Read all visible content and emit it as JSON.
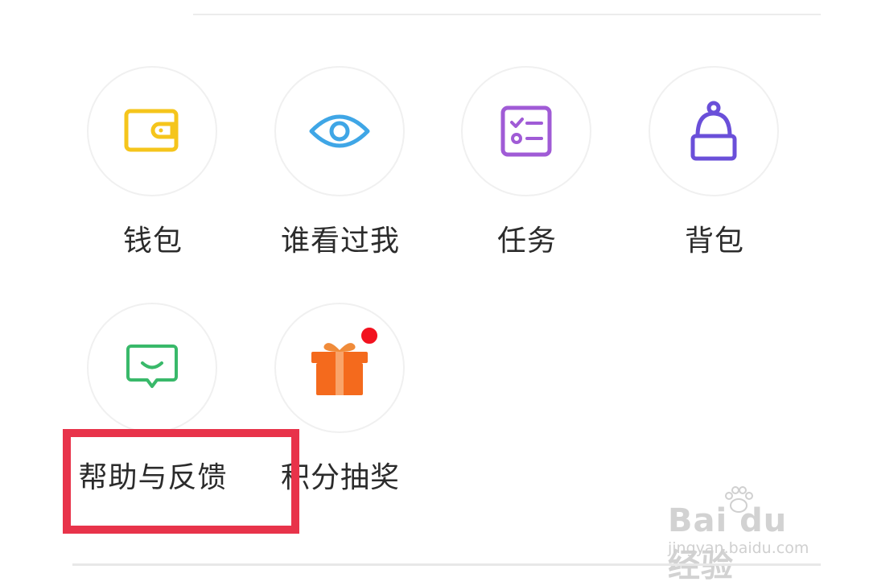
{
  "menu": {
    "items": [
      {
        "label": "钱包",
        "icon": "wallet-icon",
        "color": "#f5c51c"
      },
      {
        "label": "谁看过我",
        "icon": "eye-icon",
        "color": "#3fa6e6"
      },
      {
        "label": "任务",
        "icon": "task-list-icon",
        "color": "#a05bd6"
      },
      {
        "label": "背包",
        "icon": "backpack-icon",
        "color": "#6a4fd9"
      },
      {
        "label": "帮助与反馈",
        "icon": "feedback-chat-icon",
        "color": "#39b96a"
      },
      {
        "label": "积分抽奖",
        "icon": "gift-icon",
        "color": "#f46a1d",
        "has_notification": true
      }
    ]
  },
  "annotation": {
    "color": "#e8334a"
  },
  "watermark": {
    "brand": "Bai du 经验",
    "url": "jingyan.baidu.com"
  }
}
